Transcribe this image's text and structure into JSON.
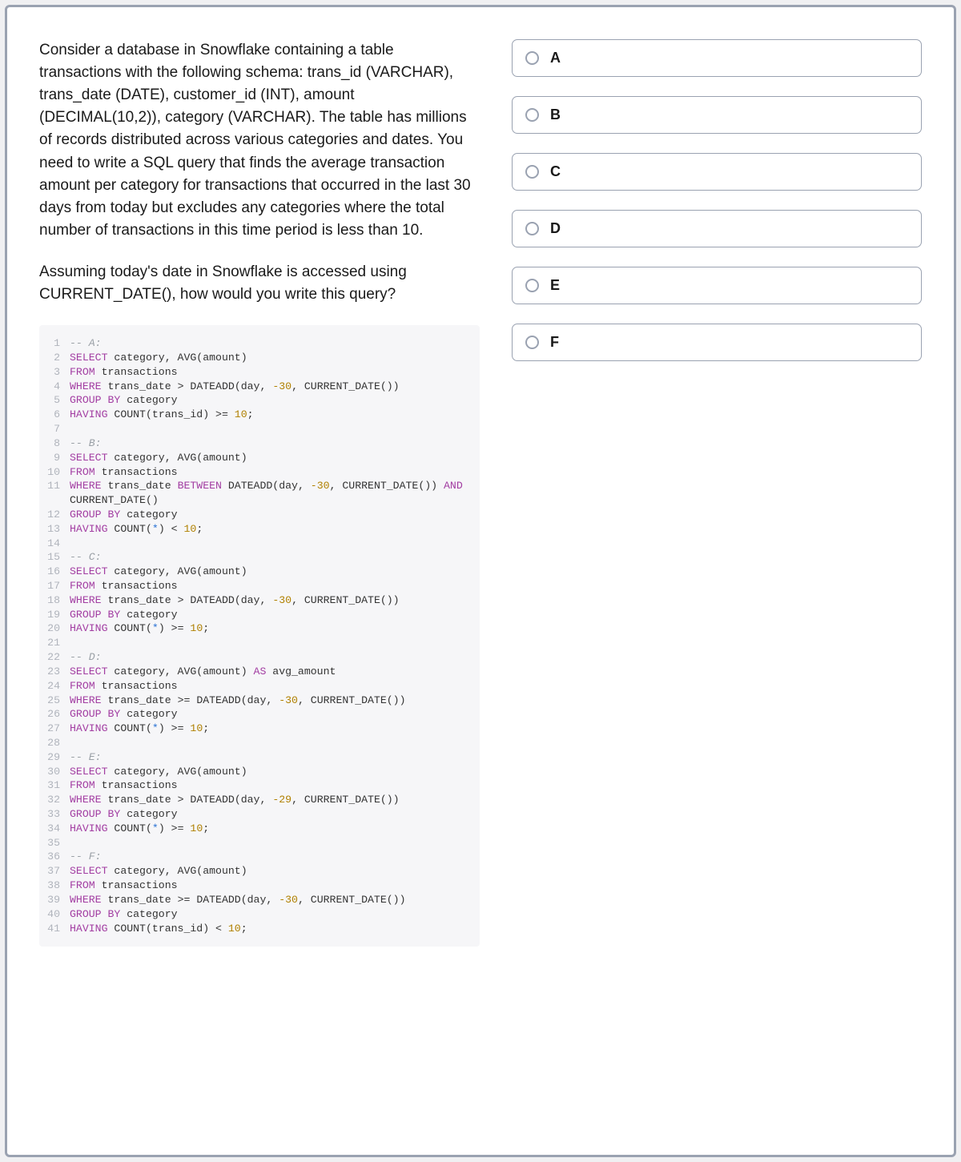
{
  "question": {
    "para1": "Consider a database in Snowflake containing a table transactions with the following schema: trans_id (VARCHAR), trans_date (DATE), customer_id (INT), amount (DECIMAL(10,2)), category (VARCHAR). The table has millions of records distributed across various categories and dates. You need to write a SQL query that finds the average transaction amount per category for transactions that occurred in the last 30 days from today but excludes any categories where the total number of transactions in this time period is less than 10.",
    "para2": "Assuming today's date in Snowflake is accessed using CURRENT_DATE(), how would you write this query?"
  },
  "code_lines": [
    {
      "n": 1,
      "tokens": [
        [
          "cmt",
          "-- A:"
        ]
      ]
    },
    {
      "n": 2,
      "tokens": [
        [
          "kw",
          "SELECT"
        ],
        [
          "sp",
          " "
        ],
        [
          "id",
          "category"
        ],
        [
          "punct",
          ", "
        ],
        [
          "fn",
          "AVG"
        ],
        [
          "punct",
          "("
        ],
        [
          "id",
          "amount"
        ],
        [
          "punct",
          ")"
        ]
      ]
    },
    {
      "n": 3,
      "tokens": [
        [
          "kw",
          "FROM"
        ],
        [
          "sp",
          " "
        ],
        [
          "id",
          "transactions"
        ]
      ]
    },
    {
      "n": 4,
      "tokens": [
        [
          "kw",
          "WHERE"
        ],
        [
          "sp",
          " "
        ],
        [
          "id",
          "trans_date"
        ],
        [
          "sp",
          " "
        ],
        [
          "op",
          ">"
        ],
        [
          "sp",
          " "
        ],
        [
          "fn",
          "DATEADD"
        ],
        [
          "punct",
          "("
        ],
        [
          "id",
          "day"
        ],
        [
          "punct",
          ", "
        ],
        [
          "num",
          "-30"
        ],
        [
          "punct",
          ", "
        ],
        [
          "fn",
          "CURRENT_DATE"
        ],
        [
          "punct",
          "())"
        ]
      ]
    },
    {
      "n": 5,
      "tokens": [
        [
          "kw",
          "GROUP BY"
        ],
        [
          "sp",
          " "
        ],
        [
          "id",
          "category"
        ]
      ]
    },
    {
      "n": 6,
      "tokens": [
        [
          "kw",
          "HAVING"
        ],
        [
          "sp",
          " "
        ],
        [
          "fn",
          "COUNT"
        ],
        [
          "punct",
          "("
        ],
        [
          "id",
          "trans_id"
        ],
        [
          "punct",
          ") "
        ],
        [
          "op",
          ">="
        ],
        [
          "sp",
          " "
        ],
        [
          "num",
          "10"
        ],
        [
          "punct",
          ";"
        ]
      ]
    },
    {
      "n": 7,
      "tokens": []
    },
    {
      "n": 8,
      "tokens": [
        [
          "cmt",
          "-- B:"
        ]
      ]
    },
    {
      "n": 9,
      "tokens": [
        [
          "kw",
          "SELECT"
        ],
        [
          "sp",
          " "
        ],
        [
          "id",
          "category"
        ],
        [
          "punct",
          ", "
        ],
        [
          "fn",
          "AVG"
        ],
        [
          "punct",
          "("
        ],
        [
          "id",
          "amount"
        ],
        [
          "punct",
          ")"
        ]
      ]
    },
    {
      "n": 10,
      "tokens": [
        [
          "kw",
          "FROM"
        ],
        [
          "sp",
          " "
        ],
        [
          "id",
          "transactions"
        ]
      ]
    },
    {
      "n": 11,
      "tokens": [
        [
          "kw",
          "WHERE"
        ],
        [
          "sp",
          " "
        ],
        [
          "id",
          "trans_date"
        ],
        [
          "sp",
          " "
        ],
        [
          "kw",
          "BETWEEN"
        ],
        [
          "sp",
          " "
        ],
        [
          "fn",
          "DATEADD"
        ],
        [
          "punct",
          "("
        ],
        [
          "id",
          "day"
        ],
        [
          "punct",
          ", "
        ],
        [
          "num",
          "-30"
        ],
        [
          "punct",
          ", "
        ],
        [
          "fn",
          "CURRENT_DATE"
        ],
        [
          "punct",
          "()) "
        ],
        [
          "kw",
          "AND"
        ]
      ],
      "wrap": [
        [
          "fn",
          "CURRENT_DATE"
        ],
        [
          "punct",
          "()"
        ]
      ]
    },
    {
      "n": 12,
      "tokens": [
        [
          "kw",
          "GROUP BY"
        ],
        [
          "sp",
          " "
        ],
        [
          "id",
          "category"
        ]
      ]
    },
    {
      "n": 13,
      "tokens": [
        [
          "kw",
          "HAVING"
        ],
        [
          "sp",
          " "
        ],
        [
          "fn",
          "COUNT"
        ],
        [
          "punct",
          "("
        ],
        [
          "star",
          "*"
        ],
        [
          "punct",
          ") "
        ],
        [
          "op",
          "<"
        ],
        [
          "sp",
          " "
        ],
        [
          "num",
          "10"
        ],
        [
          "punct",
          ";"
        ]
      ]
    },
    {
      "n": 14,
      "tokens": []
    },
    {
      "n": 15,
      "tokens": [
        [
          "cmt",
          "-- C:"
        ]
      ]
    },
    {
      "n": 16,
      "tokens": [
        [
          "kw",
          "SELECT"
        ],
        [
          "sp",
          " "
        ],
        [
          "id",
          "category"
        ],
        [
          "punct",
          ", "
        ],
        [
          "fn",
          "AVG"
        ],
        [
          "punct",
          "("
        ],
        [
          "id",
          "amount"
        ],
        [
          "punct",
          ")"
        ]
      ]
    },
    {
      "n": 17,
      "tokens": [
        [
          "kw",
          "FROM"
        ],
        [
          "sp",
          " "
        ],
        [
          "id",
          "transactions"
        ]
      ]
    },
    {
      "n": 18,
      "tokens": [
        [
          "kw",
          "WHERE"
        ],
        [
          "sp",
          " "
        ],
        [
          "id",
          "trans_date"
        ],
        [
          "sp",
          " "
        ],
        [
          "op",
          ">"
        ],
        [
          "sp",
          " "
        ],
        [
          "fn",
          "DATEADD"
        ],
        [
          "punct",
          "("
        ],
        [
          "id",
          "day"
        ],
        [
          "punct",
          ", "
        ],
        [
          "num",
          "-30"
        ],
        [
          "punct",
          ", "
        ],
        [
          "fn",
          "CURRENT_DATE"
        ],
        [
          "punct",
          "())"
        ]
      ]
    },
    {
      "n": 19,
      "tokens": [
        [
          "kw",
          "GROUP BY"
        ],
        [
          "sp",
          " "
        ],
        [
          "id",
          "category"
        ]
      ]
    },
    {
      "n": 20,
      "tokens": [
        [
          "kw",
          "HAVING"
        ],
        [
          "sp",
          " "
        ],
        [
          "fn",
          "COUNT"
        ],
        [
          "punct",
          "("
        ],
        [
          "star",
          "*"
        ],
        [
          "punct",
          ") "
        ],
        [
          "op",
          ">="
        ],
        [
          "sp",
          " "
        ],
        [
          "num",
          "10"
        ],
        [
          "punct",
          ";"
        ]
      ]
    },
    {
      "n": 21,
      "tokens": []
    },
    {
      "n": 22,
      "tokens": [
        [
          "cmt",
          "-- D:"
        ]
      ]
    },
    {
      "n": 23,
      "tokens": [
        [
          "kw",
          "SELECT"
        ],
        [
          "sp",
          " "
        ],
        [
          "id",
          "category"
        ],
        [
          "punct",
          ", "
        ],
        [
          "fn",
          "AVG"
        ],
        [
          "punct",
          "("
        ],
        [
          "id",
          "amount"
        ],
        [
          "punct",
          ") "
        ],
        [
          "kw",
          "AS"
        ],
        [
          "sp",
          " "
        ],
        [
          "id",
          "avg_amount"
        ]
      ]
    },
    {
      "n": 24,
      "tokens": [
        [
          "kw",
          "FROM"
        ],
        [
          "sp",
          " "
        ],
        [
          "id",
          "transactions"
        ]
      ]
    },
    {
      "n": 25,
      "tokens": [
        [
          "kw",
          "WHERE"
        ],
        [
          "sp",
          " "
        ],
        [
          "id",
          "trans_date"
        ],
        [
          "sp",
          " "
        ],
        [
          "op",
          ">="
        ],
        [
          "sp",
          " "
        ],
        [
          "fn",
          "DATEADD"
        ],
        [
          "punct",
          "("
        ],
        [
          "id",
          "day"
        ],
        [
          "punct",
          ", "
        ],
        [
          "num",
          "-30"
        ],
        [
          "punct",
          ", "
        ],
        [
          "fn",
          "CURRENT_DATE"
        ],
        [
          "punct",
          "())"
        ]
      ]
    },
    {
      "n": 26,
      "tokens": [
        [
          "kw",
          "GROUP BY"
        ],
        [
          "sp",
          " "
        ],
        [
          "id",
          "category"
        ]
      ]
    },
    {
      "n": 27,
      "tokens": [
        [
          "kw",
          "HAVING"
        ],
        [
          "sp",
          " "
        ],
        [
          "fn",
          "COUNT"
        ],
        [
          "punct",
          "("
        ],
        [
          "star",
          "*"
        ],
        [
          "punct",
          ") "
        ],
        [
          "op",
          ">="
        ],
        [
          "sp",
          " "
        ],
        [
          "num",
          "10"
        ],
        [
          "punct",
          ";"
        ]
      ]
    },
    {
      "n": 28,
      "tokens": []
    },
    {
      "n": 29,
      "tokens": [
        [
          "cmt",
          "-- E:"
        ]
      ]
    },
    {
      "n": 30,
      "tokens": [
        [
          "kw",
          "SELECT"
        ],
        [
          "sp",
          " "
        ],
        [
          "id",
          "category"
        ],
        [
          "punct",
          ", "
        ],
        [
          "fn",
          "AVG"
        ],
        [
          "punct",
          "("
        ],
        [
          "id",
          "amount"
        ],
        [
          "punct",
          ")"
        ]
      ]
    },
    {
      "n": 31,
      "tokens": [
        [
          "kw",
          "FROM"
        ],
        [
          "sp",
          " "
        ],
        [
          "id",
          "transactions"
        ]
      ]
    },
    {
      "n": 32,
      "tokens": [
        [
          "kw",
          "WHERE"
        ],
        [
          "sp",
          " "
        ],
        [
          "id",
          "trans_date"
        ],
        [
          "sp",
          " "
        ],
        [
          "op",
          ">"
        ],
        [
          "sp",
          " "
        ],
        [
          "fn",
          "DATEADD"
        ],
        [
          "punct",
          "("
        ],
        [
          "id",
          "day"
        ],
        [
          "punct",
          ", "
        ],
        [
          "num",
          "-29"
        ],
        [
          "punct",
          ", "
        ],
        [
          "fn",
          "CURRENT_DATE"
        ],
        [
          "punct",
          "())"
        ]
      ]
    },
    {
      "n": 33,
      "tokens": [
        [
          "kw",
          "GROUP BY"
        ],
        [
          "sp",
          " "
        ],
        [
          "id",
          "category"
        ]
      ]
    },
    {
      "n": 34,
      "tokens": [
        [
          "kw",
          "HAVING"
        ],
        [
          "sp",
          " "
        ],
        [
          "fn",
          "COUNT"
        ],
        [
          "punct",
          "("
        ],
        [
          "star",
          "*"
        ],
        [
          "punct",
          ") "
        ],
        [
          "op",
          ">="
        ],
        [
          "sp",
          " "
        ],
        [
          "num",
          "10"
        ],
        [
          "punct",
          ";"
        ]
      ]
    },
    {
      "n": 35,
      "tokens": []
    },
    {
      "n": 36,
      "tokens": [
        [
          "cmt",
          "-- F:"
        ]
      ]
    },
    {
      "n": 37,
      "tokens": [
        [
          "kw",
          "SELECT"
        ],
        [
          "sp",
          " "
        ],
        [
          "id",
          "category"
        ],
        [
          "punct",
          ", "
        ],
        [
          "fn",
          "AVG"
        ],
        [
          "punct",
          "("
        ],
        [
          "id",
          "amount"
        ],
        [
          "punct",
          ")"
        ]
      ]
    },
    {
      "n": 38,
      "tokens": [
        [
          "kw",
          "FROM"
        ],
        [
          "sp",
          " "
        ],
        [
          "id",
          "transactions"
        ]
      ]
    },
    {
      "n": 39,
      "tokens": [
        [
          "kw",
          "WHERE"
        ],
        [
          "sp",
          " "
        ],
        [
          "id",
          "trans_date"
        ],
        [
          "sp",
          " "
        ],
        [
          "op",
          ">="
        ],
        [
          "sp",
          " "
        ],
        [
          "fn",
          "DATEADD"
        ],
        [
          "punct",
          "("
        ],
        [
          "id",
          "day"
        ],
        [
          "punct",
          ", "
        ],
        [
          "num",
          "-30"
        ],
        [
          "punct",
          ", "
        ],
        [
          "fn",
          "CURRENT_DATE"
        ],
        [
          "punct",
          "())"
        ]
      ]
    },
    {
      "n": 40,
      "tokens": [
        [
          "kw",
          "GROUP BY"
        ],
        [
          "sp",
          " "
        ],
        [
          "id",
          "category"
        ]
      ]
    },
    {
      "n": 41,
      "tokens": [
        [
          "kw",
          "HAVING"
        ],
        [
          "sp",
          " "
        ],
        [
          "fn",
          "COUNT"
        ],
        [
          "punct",
          "("
        ],
        [
          "id",
          "trans_id"
        ],
        [
          "punct",
          ") "
        ],
        [
          "op",
          "<"
        ],
        [
          "sp",
          " "
        ],
        [
          "num",
          "10"
        ],
        [
          "punct",
          ";"
        ]
      ]
    }
  ],
  "answers": [
    {
      "key": "A",
      "label": "A"
    },
    {
      "key": "B",
      "label": "B"
    },
    {
      "key": "C",
      "label": "C"
    },
    {
      "key": "D",
      "label": "D"
    },
    {
      "key": "E",
      "label": "E"
    },
    {
      "key": "F",
      "label": "F"
    }
  ]
}
